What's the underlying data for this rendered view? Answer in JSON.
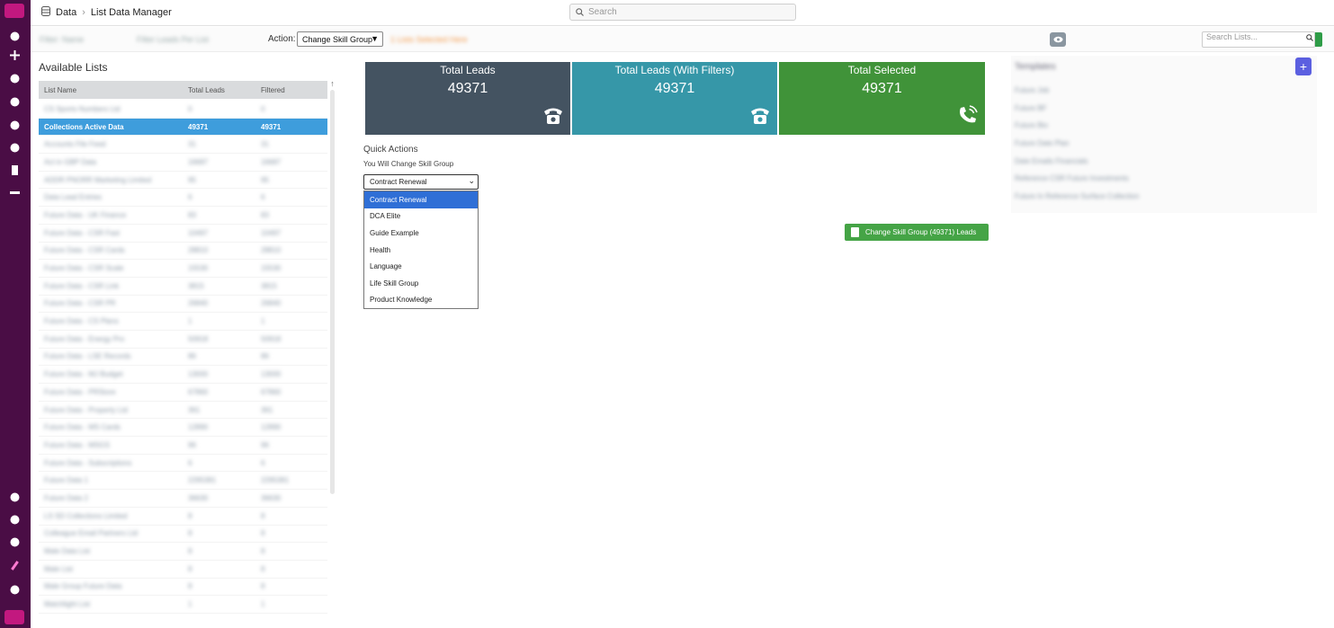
{
  "topbar": {
    "breadcrumb": [
      "Data",
      "List Data Manager"
    ],
    "search_placeholder": "Search"
  },
  "filters": {
    "filter_a": "Filter: Name",
    "filter_b": "Filter Leads Per List",
    "action_label": "Action:",
    "action_value": "Change Skill Group",
    "action_note": "1 Lists Selected Here",
    "list_search_placeholder": "Search Lists..."
  },
  "available_lists": {
    "title": "Available Lists",
    "columns": [
      "List Name",
      "Total Leads",
      "Filtered"
    ],
    "rows": [
      {
        "name": "CS Sports Numbers Ltd",
        "total": "0",
        "filtered": "0"
      },
      {
        "name": "Collections Active Data",
        "total": "49371",
        "filtered": "49371",
        "selected": true
      },
      {
        "name": "Accounts File Feed",
        "total": "31",
        "filtered": "31"
      },
      {
        "name": "Act in GBP Data",
        "total": "16687",
        "filtered": "16687"
      },
      {
        "name": "ADDR PNORR Marketing Limited",
        "total": "95",
        "filtered": "95"
      },
      {
        "name": "Data Lead Entries",
        "total": "6",
        "filtered": "6"
      },
      {
        "name": "Future Data - UK Finance",
        "total": "83",
        "filtered": "83"
      },
      {
        "name": "Future Data - CSR Fast",
        "total": "10497",
        "filtered": "10497"
      },
      {
        "name": "Future Data - CSR Cards",
        "total": "28810",
        "filtered": "28810"
      },
      {
        "name": "Future Data - CSR Scale",
        "total": "15530",
        "filtered": "15530"
      },
      {
        "name": "Future Data - CSR Link",
        "total": "3815",
        "filtered": "3815"
      },
      {
        "name": "Future Data - CSR PR",
        "total": "26840",
        "filtered": "26840"
      },
      {
        "name": "Future Data - CS Plans",
        "total": "1",
        "filtered": "1"
      },
      {
        "name": "Future Data - Energy Pro",
        "total": "50918",
        "filtered": "50918"
      },
      {
        "name": "Future Data - LSE Records",
        "total": "86",
        "filtered": "86"
      },
      {
        "name": "Future Data - MJ Budget",
        "total": "13000",
        "filtered": "13000"
      },
      {
        "name": "Future Data - PRStore",
        "total": "67860",
        "filtered": "67860"
      },
      {
        "name": "Future Data - Property Ltd",
        "total": "361",
        "filtered": "361"
      },
      {
        "name": "Future Data - MS Cards",
        "total": "12890",
        "filtered": "12890"
      },
      {
        "name": "Future Data - MSGS",
        "total": "96",
        "filtered": "96"
      },
      {
        "name": "Future Data - Subscriptions",
        "total": "6",
        "filtered": "6"
      },
      {
        "name": "Future Data 1",
        "total": "2295381",
        "filtered": "2295381"
      },
      {
        "name": "Future Data 2",
        "total": "36630",
        "filtered": "36630"
      },
      {
        "name": "LS SD Collections Limited",
        "total": "8",
        "filtered": "8"
      },
      {
        "name": "Colleague Email Partners Ltd",
        "total": "8",
        "filtered": "8"
      },
      {
        "name": "Male Data List",
        "total": "8",
        "filtered": "8"
      },
      {
        "name": "Male List",
        "total": "8",
        "filtered": "8"
      },
      {
        "name": "Male Group Future Data",
        "total": "8",
        "filtered": "8"
      },
      {
        "name": "Matchlight List",
        "total": "1",
        "filtered": "1"
      }
    ]
  },
  "tiles": [
    {
      "title": "Total Leads",
      "value": "49371",
      "icon": "phone-icon",
      "color": "#445361"
    },
    {
      "title": "Total Leads (With Filters)",
      "value": "49371",
      "icon": "phone-icon",
      "color": "#3697a8"
    },
    {
      "title": "Total Selected",
      "value": "49371",
      "icon": "phone-ringing-icon",
      "color": "#409339"
    }
  ],
  "quick_actions": {
    "title": "Quick Actions",
    "subtitle": "You Will Change Skill Group",
    "selected": "Contract Renewal",
    "options": [
      "Contract Renewal",
      "DCA Elite",
      "Guide Example",
      "Health",
      "Language",
      "Life Skill Group",
      "Product Knowledge"
    ],
    "button_label": "Change Skill Group (49371) Leads"
  },
  "templates": {
    "title": "Templates",
    "items": [
      "Future Job",
      "Future BF",
      "Future Bio",
      "Future Date Plan",
      "Date Emails Financials",
      "Reference CSR Future Investments",
      "Future In Reference Surface Collection"
    ]
  },
  "colors": {
    "nav_bg": "#4a0d45",
    "selected_row": "#3e9ddc",
    "action_green": "#45a446",
    "dropdown_active": "#2f6fd6"
  }
}
